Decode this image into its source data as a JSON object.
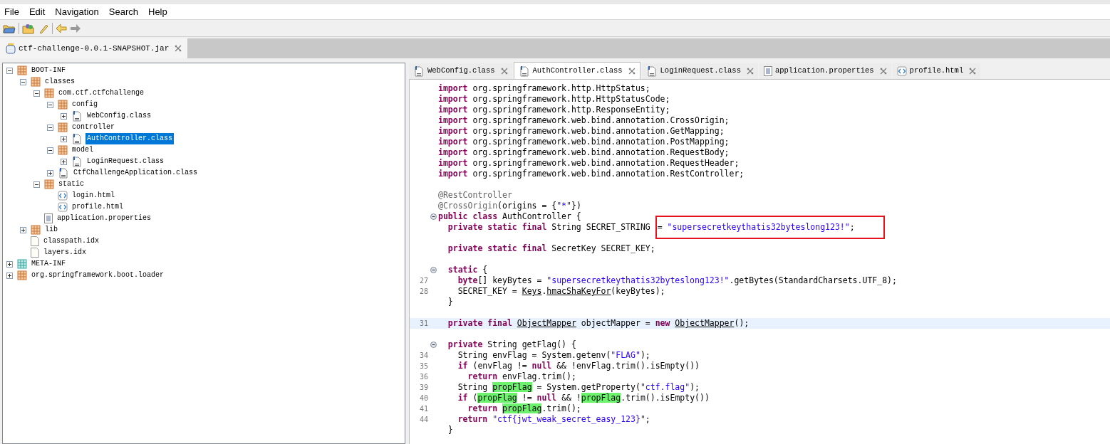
{
  "menu": [
    "File",
    "Edit",
    "Navigation",
    "Search",
    "Help"
  ],
  "file_tabs": [
    {
      "label": "ctf-challenge-0.0.1-SNAPSHOT.jar",
      "selected": true
    }
  ],
  "tree": [
    {
      "label": "BOOT-INF",
      "kind": "package",
      "expanded": true,
      "selected": false,
      "children": [
        {
          "label": "classes",
          "kind": "package",
          "expanded": true,
          "selected": false,
          "children": [
            {
              "label": "com.ctf.ctfchallenge",
              "kind": "package",
              "expanded": true,
              "selected": false,
              "children": [
                {
                  "label": "config",
                  "kind": "package",
                  "expanded": true,
                  "selected": false,
                  "children": [
                    {
                      "label": "WebConfig.class",
                      "kind": "class",
                      "expanded": false,
                      "selected": false
                    }
                  ]
                },
                {
                  "label": "controller",
                  "kind": "package",
                  "expanded": true,
                  "selected": false,
                  "children": [
                    {
                      "label": "AuthController.class",
                      "kind": "class",
                      "expanded": false,
                      "selected": true
                    }
                  ]
                },
                {
                  "label": "model",
                  "kind": "package",
                  "expanded": true,
                  "selected": false,
                  "children": [
                    {
                      "label": "LoginRequest.class",
                      "kind": "class",
                      "expanded": false,
                      "selected": false
                    }
                  ]
                },
                {
                  "label": "CtfChallengeApplication.class",
                  "kind": "class",
                  "expanded": false,
                  "selected": false
                }
              ]
            },
            {
              "label": "static",
              "kind": "package",
              "expanded": true,
              "selected": false,
              "children": [
                {
                  "label": "login.html",
                  "kind": "html",
                  "selected": false
                },
                {
                  "label": "profile.html",
                  "kind": "html",
                  "selected": false
                }
              ]
            },
            {
              "label": "application.properties",
              "kind": "properties",
              "selected": false
            }
          ]
        },
        {
          "label": "lib",
          "kind": "package",
          "expanded": false,
          "selected": false
        },
        {
          "label": "classpath.idx",
          "kind": "file",
          "selected": false
        },
        {
          "label": "layers.idx",
          "kind": "file",
          "selected": false
        }
      ]
    },
    {
      "label": "META-INF",
      "kind": "meta",
      "expanded": false,
      "selected": false
    },
    {
      "label": "org.springframework.boot.loader",
      "kind": "package",
      "expanded": false,
      "selected": false
    }
  ],
  "editor_tabs": [
    {
      "label": "WebConfig.class",
      "kind": "class",
      "selected": false
    },
    {
      "label": "AuthController.class",
      "kind": "class",
      "selected": true
    },
    {
      "label": "LoginRequest.class",
      "kind": "class",
      "selected": false
    },
    {
      "label": "application.properties",
      "kind": "properties",
      "selected": false
    },
    {
      "label": "profile.html",
      "kind": "html",
      "selected": false
    }
  ],
  "code": [
    {
      "fold": false,
      "current": false,
      "tokens": [
        {
          "kind": "kw",
          "t": "import"
        },
        {
          "kind": "p",
          "t": " org.springframework.http.HttpStatus;"
        }
      ]
    },
    {
      "fold": false,
      "current": false,
      "tokens": [
        {
          "kind": "kw",
          "t": "import"
        },
        {
          "kind": "p",
          "t": " org.springframework.http.HttpStatusCode;"
        }
      ]
    },
    {
      "fold": false,
      "current": false,
      "tokens": [
        {
          "kind": "kw",
          "t": "import"
        },
        {
          "kind": "p",
          "t": " org.springframework.http.ResponseEntity;"
        }
      ]
    },
    {
      "fold": false,
      "current": false,
      "tokens": [
        {
          "kind": "kw",
          "t": "import"
        },
        {
          "kind": "p",
          "t": " org.springframework.web.bind.annotation.CrossOrigin;"
        }
      ]
    },
    {
      "fold": false,
      "current": false,
      "tokens": [
        {
          "kind": "kw",
          "t": "import"
        },
        {
          "kind": "p",
          "t": " org.springframework.web.bind.annotation.GetMapping;"
        }
      ]
    },
    {
      "fold": false,
      "current": false,
      "tokens": [
        {
          "kind": "kw",
          "t": "import"
        },
        {
          "kind": "p",
          "t": " org.springframework.web.bind.annotation.PostMapping;"
        }
      ]
    },
    {
      "fold": false,
      "current": false,
      "tokens": [
        {
          "kind": "kw",
          "t": "import"
        },
        {
          "kind": "p",
          "t": " org.springframework.web.bind.annotation.RequestBody;"
        }
      ]
    },
    {
      "fold": false,
      "current": false,
      "tokens": [
        {
          "kind": "kw",
          "t": "import"
        },
        {
          "kind": "p",
          "t": " org.springframework.web.bind.annotation.RequestHeader;"
        }
      ]
    },
    {
      "fold": false,
      "current": false,
      "tokens": [
        {
          "kind": "kw",
          "t": "import"
        },
        {
          "kind": "p",
          "t": " org.springframework.web.bind.annotation.RestController;"
        }
      ]
    },
    {
      "fold": false,
      "current": false
    },
    {
      "fold": false,
      "current": false,
      "tokens": [
        {
          "kind": "ann",
          "t": "@RestController"
        }
      ]
    },
    {
      "fold": false,
      "current": false,
      "tokens": [
        {
          "kind": "ann",
          "t": "@CrossOrigin"
        },
        {
          "kind": "p",
          "t": "(origins = {"
        },
        {
          "kind": "str",
          "t": "\"*\""
        },
        {
          "kind": "p",
          "t": "})"
        }
      ]
    },
    {
      "fold": true,
      "current": false,
      "tokens": [
        {
          "kind": "kw",
          "t": "public class"
        },
        {
          "kind": "p",
          "t": " AuthController {"
        }
      ]
    },
    {
      "fold": false,
      "current": false,
      "tokens": [
        {
          "kind": "kw",
          "t": "  private static final"
        },
        {
          "kind": "p",
          "t": " String SECRET_STRING "
        },
        {
          "kind": "p",
          "t": "= ",
          "boxed": true
        },
        {
          "kind": "str",
          "t": "\"supersecretkeythatis32byteslong123!\"",
          "boxed": true
        },
        {
          "kind": "p",
          "t": ";",
          "boxed": true
        }
      ]
    },
    {
      "fold": false,
      "current": false
    },
    {
      "fold": false,
      "current": false,
      "tokens": [
        {
          "kind": "kw",
          "t": "  private static final"
        },
        {
          "kind": "p",
          "t": " SecretKey SECRET_KEY;"
        }
      ]
    },
    {
      "fold": false,
      "current": false
    },
    {
      "fold": true,
      "current": false,
      "tokens": [
        {
          "kind": "kw",
          "t": "  static"
        },
        {
          "kind": "p",
          "t": " {"
        }
      ]
    },
    {
      "num": "27",
      "fold": false,
      "current": false,
      "tokens": [
        {
          "kind": "kw",
          "t": "    byte"
        },
        {
          "kind": "p",
          "t": "[] keyBytes = "
        },
        {
          "kind": "str",
          "t": "\"supersecretkeythatis32byteslong123!\""
        },
        {
          "kind": "p",
          "t": ".getBytes(StandardCharsets.UTF_8);"
        }
      ]
    },
    {
      "num": "28",
      "fold": false,
      "current": false,
      "tokens": [
        {
          "kind": "p",
          "t": "    SECRET_KEY = "
        },
        {
          "kind": "ul",
          "t": "Keys"
        },
        {
          "kind": "p",
          "t": "."
        },
        {
          "kind": "ul",
          "t": "hmacShaKeyFor"
        },
        {
          "kind": "p",
          "t": "(keyBytes);"
        }
      ]
    },
    {
      "fold": false,
      "current": false,
      "tokens": [
        {
          "kind": "p",
          "t": "  }"
        }
      ]
    },
    {
      "fold": false,
      "current": false
    },
    {
      "num": "31",
      "fold": false,
      "current": true,
      "tokens": [
        {
          "kind": "kw",
          "t": "  private final "
        },
        {
          "kind": "ul",
          "t": "ObjectMapper"
        },
        {
          "kind": "p",
          "t": " objectMapper = "
        },
        {
          "kind": "kw",
          "t": "new "
        },
        {
          "kind": "ul",
          "t": "ObjectMapper"
        },
        {
          "kind": "p",
          "t": "();"
        }
      ]
    },
    {
      "fold": false,
      "current": false
    },
    {
      "fold": true,
      "current": false,
      "tokens": [
        {
          "kind": "kw",
          "t": "  private"
        },
        {
          "kind": "p",
          "t": " String getFlag() {"
        }
      ]
    },
    {
      "num": "34",
      "fold": false,
      "current": false,
      "tokens": [
        {
          "kind": "p",
          "t": "    String envFlag = System.getenv("
        },
        {
          "kind": "str",
          "t": "\"FLAG\""
        },
        {
          "kind": "p",
          "t": ");"
        }
      ]
    },
    {
      "num": "35",
      "fold": false,
      "current": false,
      "tokens": [
        {
          "kind": "kw",
          "t": "    if"
        },
        {
          "kind": "p",
          "t": " (envFlag != "
        },
        {
          "kind": "kw",
          "t": "null"
        },
        {
          "kind": "p",
          "t": " && !envFlag.trim().isEmpty())"
        }
      ]
    },
    {
      "num": "36",
      "fold": false,
      "current": false,
      "tokens": [
        {
          "kind": "kw",
          "t": "      return"
        },
        {
          "kind": "p",
          "t": " envFlag.trim();"
        }
      ]
    },
    {
      "num": "39",
      "fold": false,
      "current": false,
      "tokens": [
        {
          "kind": "p",
          "t": "    String "
        },
        {
          "kind": "hl",
          "t": "propFlag"
        },
        {
          "kind": "p",
          "t": " = System.getProperty("
        },
        {
          "kind": "str",
          "t": "\"ctf.flag\""
        },
        {
          "kind": "p",
          "t": ");"
        }
      ]
    },
    {
      "num": "40",
      "fold": false,
      "current": false,
      "tokens": [
        {
          "kind": "kw",
          "t": "    if"
        },
        {
          "kind": "p",
          "t": " ("
        },
        {
          "kind": "hl",
          "t": "propFlag"
        },
        {
          "kind": "p",
          "t": " != "
        },
        {
          "kind": "kw",
          "t": "null"
        },
        {
          "kind": "p",
          "t": " && !"
        },
        {
          "kind": "hl",
          "t": "propFlag"
        },
        {
          "kind": "p",
          "t": ".trim().isEmpty())"
        }
      ]
    },
    {
      "num": "41",
      "fold": false,
      "current": false,
      "tokens": [
        {
          "kind": "kw",
          "t": "      return "
        },
        {
          "kind": "hl",
          "t": "propFlag"
        },
        {
          "kind": "p",
          "t": ".trim();"
        }
      ]
    },
    {
      "num": "44",
      "fold": false,
      "current": false,
      "tokens": [
        {
          "kind": "kw",
          "t": "    return "
        },
        {
          "kind": "str",
          "t": "\"ctf{jwt_weak_secret_easy_123}\""
        },
        {
          "kind": "p",
          "t": ";"
        }
      ]
    },
    {
      "fold": false,
      "current": false,
      "tokens": [
        {
          "kind": "p",
          "t": "  }"
        }
      ]
    }
  ]
}
